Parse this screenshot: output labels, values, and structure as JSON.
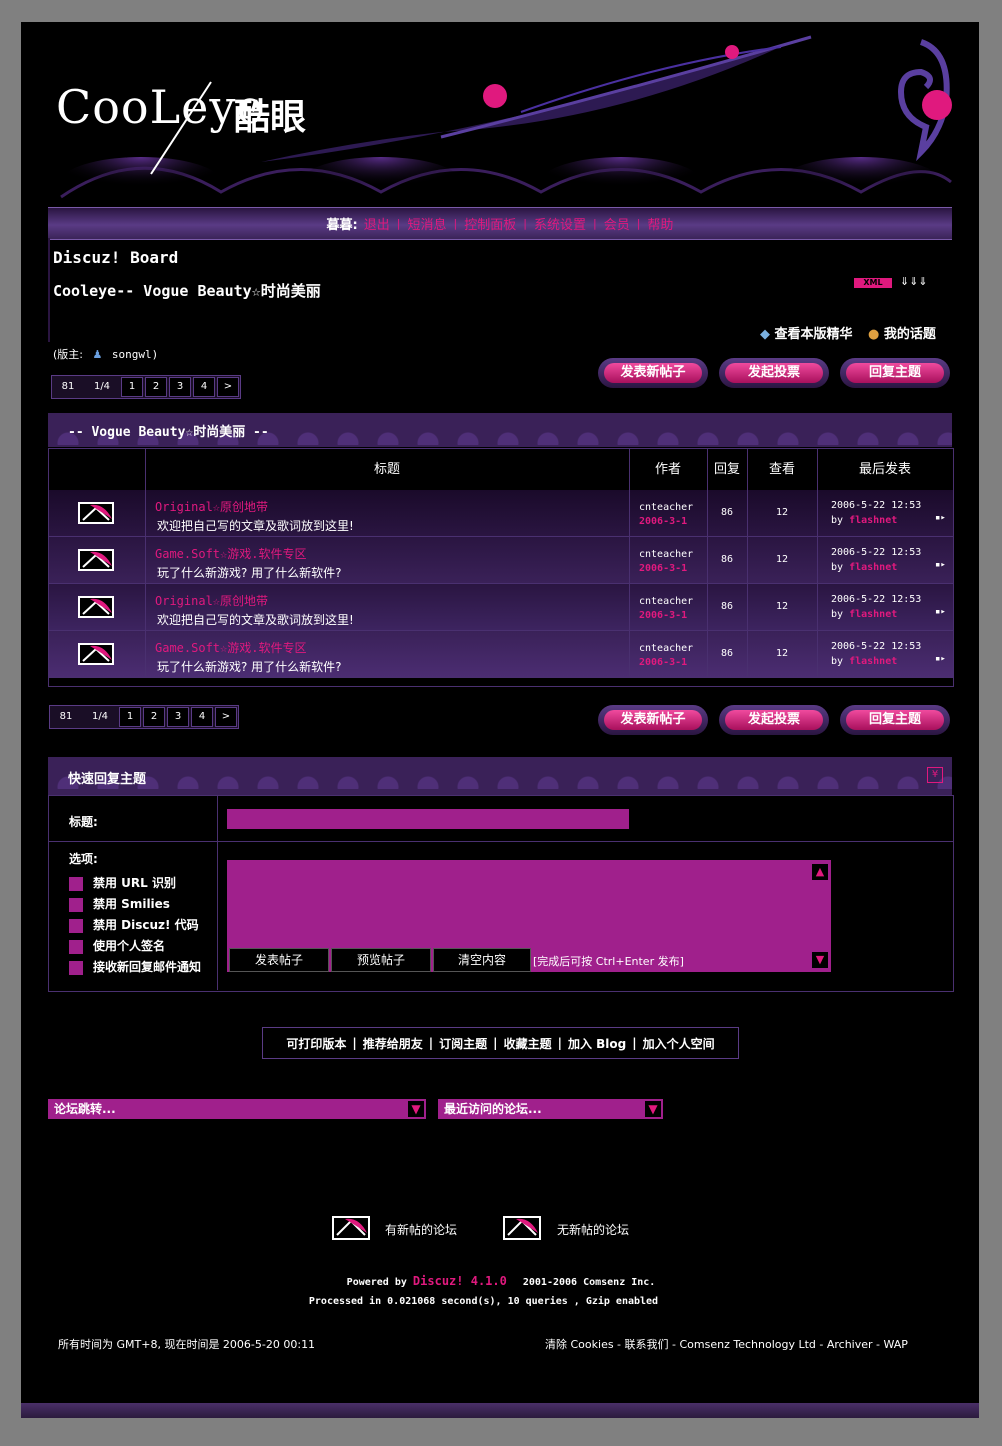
{
  "header": {
    "logo_text": "CooLeye",
    "logo_cn": "酷眼"
  },
  "menu": {
    "user": "暮暮:",
    "items": [
      "退出",
      "短消息",
      "控制面板",
      "系统设置",
      "会员",
      "帮助"
    ]
  },
  "board": {
    "title": "Discuz! Board",
    "subtitle": "Cooleye-- Vogue Beauty☆时尚美丽",
    "xml_badge": "XML",
    "links": [
      "查看本版精华",
      "我的话题"
    ],
    "moderator_label": "(版主:",
    "moderator_name": "songwl)"
  },
  "pager": {
    "total": "81",
    "page_of": "1/4",
    "pages": [
      "1",
      "2",
      "3",
      "4"
    ],
    "next": ">"
  },
  "actions": {
    "new_thread": "发表新帖子",
    "new_poll": "发起投票",
    "reply": "回复主题"
  },
  "section_title": "-- Vogue Beauty☆时尚美丽 --",
  "table": {
    "headers": [
      "标题",
      "作者",
      "回复",
      "查看",
      "最后发表"
    ],
    "rows": [
      {
        "title_en": "Original",
        "title_cn": "☆原创地带",
        "desc": "欢迎把自己写的文章及歌词放到这里!",
        "author": "cnteacher",
        "date": "2006-3-1",
        "replies": "86",
        "views": "12",
        "last_time": "2006-5-22 12:53",
        "by": "by",
        "last_user": "flashnet"
      },
      {
        "title_en": "Game.Soft",
        "title_cn": "☆游戏.软件专区",
        "desc": "玩了什么新游戏? 用了什么新软件?",
        "author": "cnteacher",
        "date": "2006-3-1",
        "replies": "86",
        "views": "12",
        "last_time": "2006-5-22 12:53",
        "by": "by",
        "last_user": "flashnet"
      },
      {
        "title_en": "Original",
        "title_cn": "☆原创地带",
        "desc": "欢迎把自己写的文章及歌词放到这里!",
        "author": "cnteacher",
        "date": "2006-3-1",
        "replies": "86",
        "views": "12",
        "last_time": "2006-5-22 12:53",
        "by": "by",
        "last_user": "flashnet"
      },
      {
        "title_en": "Game.Soft",
        "title_cn": "☆游戏.软件专区",
        "desc": "玩了什么新游戏? 用了什么新软件?",
        "author": "cnteacher",
        "date": "2006-3-1",
        "replies": "86",
        "views": "12",
        "last_time": "2006-5-22 12:53",
        "by": "by",
        "last_user": "flashnet"
      }
    ]
  },
  "quick_reply": {
    "heading": "快速回复主题",
    "title_label": "标题:",
    "options_label": "选项:",
    "options": [
      "禁用 URL 识别",
      "禁用 Smilies",
      "禁用 Discuz! 代码",
      "使用个人签名",
      "接收新回复邮件通知"
    ],
    "submit": "发表帖子",
    "preview": "预览帖子",
    "clear": "清空内容",
    "hint": "[完成后可按 Ctrl+Enter 发布]"
  },
  "toolbar": [
    "可打印版本",
    "推荐给朋友",
    "订阅主题",
    "收藏主题",
    "加入 Blog",
    "加入个人空间"
  ],
  "jump": {
    "forum_jump": "论坛跳转...",
    "recent": "最近访问的论坛..."
  },
  "legend": {
    "new": "有新帖的论坛",
    "none": "无新帖的论坛"
  },
  "footer": {
    "powered_prefix": "Powered by",
    "product": "Discuz! 4.1.0",
    "copyright": "2001-2006 Comsenz Inc.",
    "processed": "Processed in 0.021068 second(s), 10 queries , Gzip enabled",
    "time_text": "所有时间为 GMT+8, 现在时间是 2006-5-20 00:11",
    "links": "清除 Cookies - 联系我们 - Comsenz Technology Ltd - Archiver - WAP"
  },
  "colors": {
    "accent": "#e0197e",
    "purple": "#5a3b85",
    "magenta_field": "#a0208c"
  }
}
